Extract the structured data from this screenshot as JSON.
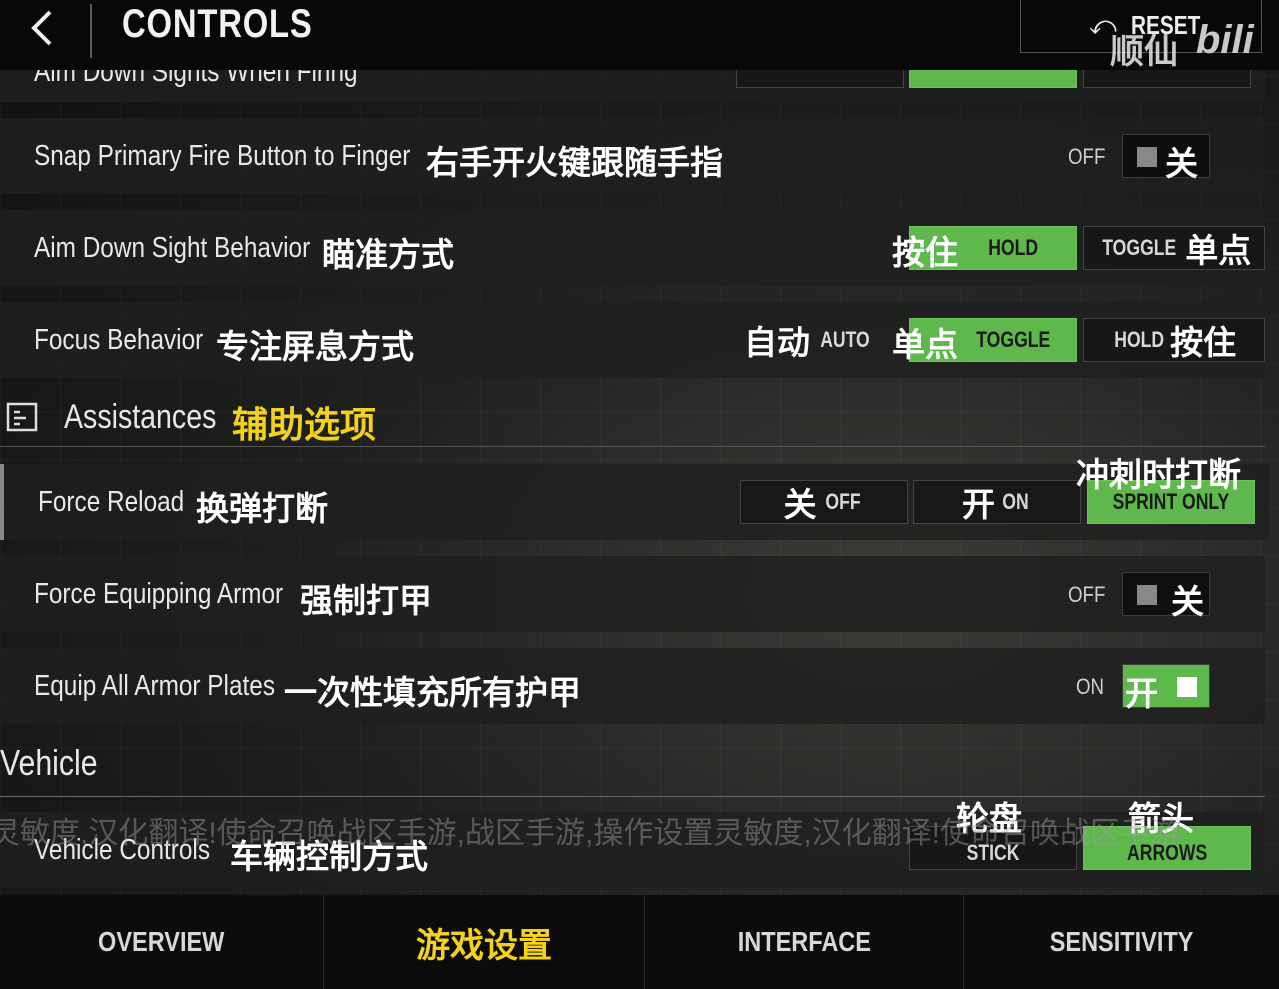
{
  "header": {
    "title": "CONTROLS",
    "reset_label": "RESET",
    "watermark_zh": "顺仙",
    "watermark_logo": "bili"
  },
  "cut_row": {
    "label": "Aim Down Sights When Firing"
  },
  "rows": {
    "snap_fire": {
      "label": "Snap Primary Fire Button to Finger",
      "zh": "右手开火键跟随手指",
      "state": "OFF",
      "state_zh": "关",
      "on": false
    },
    "ads_behavior": {
      "label": "Aim Down Sight Behavior",
      "zh": "瞄准方式",
      "options": [
        {
          "en": "HOLD",
          "zh": "按住",
          "selected": true
        },
        {
          "en": "TOGGLE",
          "zh": "单点",
          "selected": false
        }
      ]
    },
    "focus_behavior": {
      "label": "Focus Behavior",
      "zh": "专注屏息方式",
      "options": [
        {
          "en": "AUTO",
          "zh": "自动",
          "selected": false
        },
        {
          "en": "TOGGLE",
          "zh": "单点",
          "selected": true
        },
        {
          "en": "HOLD",
          "zh": "按住",
          "selected": false
        }
      ]
    }
  },
  "assistances": {
    "title": "Assistances",
    "zh": "辅助选项"
  },
  "assist_rows": {
    "force_reload": {
      "label": "Force Reload",
      "zh": "换弹打断",
      "options": [
        {
          "en": "OFF",
          "zh": "关",
          "selected": false
        },
        {
          "en": "ON",
          "zh": "开",
          "selected": false
        },
        {
          "en": "SPRINT ONLY",
          "zh": "冲刺时打断",
          "selected": true
        }
      ]
    },
    "force_armor": {
      "label": "Force Equipping Armor",
      "zh": "强制打甲",
      "state": "OFF",
      "state_zh": "关",
      "on": false
    },
    "equip_all": {
      "label": "Equip All Armor Plates",
      "zh": "一次性填充所有护甲",
      "state": "ON",
      "state_zh": "开",
      "on": true
    }
  },
  "vehicle": {
    "title": "Vehicle",
    "ticker": "灵敏度,汉化翻译!使命召唤战区手游,战区手游,操作设置灵敏度,汉化翻译!使命召唤战区手游",
    "controls": {
      "label": "Vehicle Controls",
      "zh": "车辆控制方式",
      "options": [
        {
          "en": "STICK",
          "zh": "轮盘",
          "selected": false
        },
        {
          "en": "ARROWS",
          "zh": "箭头",
          "selected": true
        }
      ]
    }
  },
  "tabs": [
    {
      "label": "OVERVIEW",
      "active": false
    },
    {
      "label": "游戏设置",
      "active": true
    },
    {
      "label": "INTERFACE",
      "active": false
    },
    {
      "label": "SENSITIVITY",
      "active": false
    }
  ],
  "colors": {
    "accent_green": "#5fb84c",
    "highlight_yellow": "#f4d21c"
  },
  "icons": [
    "back-arrow-icon",
    "reset-icon",
    "list-icon"
  ]
}
